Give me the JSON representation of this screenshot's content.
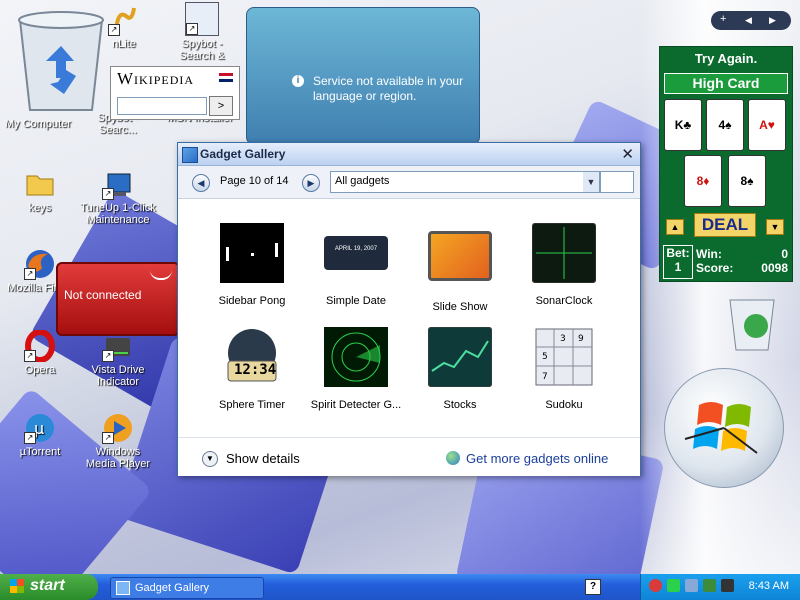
{
  "desktop": {
    "icons": [
      {
        "label": "My Computer",
        "icon": "recycle-bin-icon"
      },
      {
        "label": "nLite",
        "icon": "nlite-icon"
      },
      {
        "label": "Spybot - Search &",
        "icon": "spybot-icon"
      },
      {
        "label": "Spybot - Searc...",
        "icon": "spybot-icon"
      },
      {
        "label": "MSN Installer",
        "icon": "msn-icon"
      },
      {
        "label": "keys",
        "icon": "folder-icon"
      },
      {
        "label": "TuneUp 1-Click Maintenance",
        "icon": "tuneup-icon"
      },
      {
        "label": "Mozilla Fire...",
        "icon": "firefox-icon"
      },
      {
        "label": "Opera",
        "icon": "opera-icon"
      },
      {
        "label": "Vista Drive Indicator",
        "icon": "drive-icon"
      },
      {
        "label": "µTorrent",
        "icon": "utorrent-icon"
      },
      {
        "label": "Windows Media Player",
        "icon": "media-player-icon"
      }
    ]
  },
  "wikipedia": {
    "title": "Wikipedia",
    "go": ">"
  },
  "service": {
    "message": "Service not available in your language or region."
  },
  "sidebar_controls": {
    "add": "+",
    "prev": "◀",
    "next": "▶"
  },
  "cards": {
    "status": "Try Again.",
    "game": "High Card",
    "top_cards": [
      {
        "rank": "K",
        "suit": "♣"
      },
      {
        "rank": "4",
        "suit": "♠"
      },
      {
        "rank": "A",
        "suit": "♥"
      }
    ],
    "bottom_cards": [
      {
        "rank": "8",
        "suit": "♦"
      },
      {
        "rank": "8",
        "suit": "♠"
      }
    ],
    "deal": "DEAL",
    "bet_label": "Bet:",
    "bet": "1",
    "win_label": "Win:",
    "win": "0",
    "score_label": "Score:",
    "score": "0098"
  },
  "notconnected": {
    "text": "Not connected"
  },
  "gallery": {
    "title": "Gadget Gallery",
    "page": "Page 10 of 14",
    "filter": "All gadgets",
    "gadgets": [
      {
        "label": "Sidebar Pong",
        "icon": "pong-icon"
      },
      {
        "label": "Simple Date",
        "icon": "date-icon",
        "date_text": "APRIL 19, 2007"
      },
      {
        "label": "Slide Show",
        "icon": "slideshow-icon"
      },
      {
        "label": "SonarClock",
        "icon": "sonar-clock-icon"
      },
      {
        "label": "Sphere Timer",
        "icon": "sphere-timer-icon",
        "time": "12:34"
      },
      {
        "label": "Spirit Detecter G...",
        "icon": "radar-icon"
      },
      {
        "label": "Stocks",
        "icon": "stocks-icon"
      },
      {
        "label": "Sudoku",
        "icon": "sudoku-icon"
      }
    ],
    "show_details": "Show details",
    "get_more": "Get more gadgets online"
  },
  "taskbar": {
    "start": "start",
    "task": "Gadget Gallery",
    "clock": "8:43 AM",
    "help": "?"
  }
}
